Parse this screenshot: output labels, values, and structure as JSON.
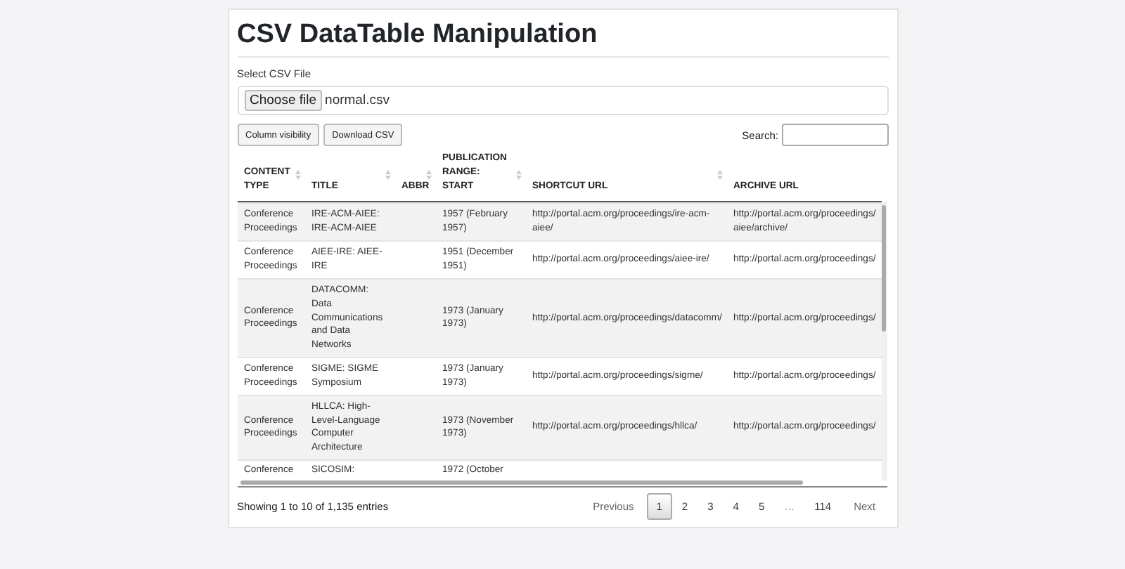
{
  "title": "CSV DataTable Manipulation",
  "file_picker": {
    "label": "Select CSV File",
    "button": "Choose file",
    "file_name": "normal.csv"
  },
  "buttons": [
    "Column visibility",
    "Download CSV"
  ],
  "search": {
    "label": "Search:"
  },
  "table": {
    "columns": [
      {
        "label": "CONTENT TYPE",
        "sortable": true
      },
      {
        "label": "TITLE",
        "sortable": true
      },
      {
        "label": "ABBR",
        "sortable": true
      },
      {
        "label": "PUBLICATION RANGE: START",
        "sortable": true
      },
      {
        "label": "SHORTCUT URL",
        "sortable": true
      },
      {
        "label": "ARCHIVE URL",
        "sortable": false
      }
    ],
    "rows": [
      [
        "Conference Proceedings",
        "IRE-ACM-AIEE: IRE-ACM-AIEE",
        "",
        "1957 (February 1957)",
        "http://portal.acm.org/proceedings/ire-acm-aiee/",
        "http://portal.acm.org/proceedings/ aiee/archive/"
      ],
      [
        "Conference Proceedings",
        "AIEE-IRE: AIEE-IRE",
        "",
        "1951 (December 1951)",
        "http://portal.acm.org/proceedings/aiee-ire/",
        "http://portal.acm.org/proceedings/"
      ],
      [
        "Conference Proceedings",
        "DATACOMM: Data Communications and Data Networks",
        "",
        "1973 (January 1973)",
        "http://portal.acm.org/proceedings/datacomm/",
        "http://portal.acm.org/proceedings/"
      ],
      [
        "Conference Proceedings",
        "SIGME: SIGME Symposium",
        "",
        "1973 (January 1973)",
        "http://portal.acm.org/proceedings/sigme/",
        "http://portal.acm.org/proceedings/"
      ],
      [
        "Conference Proceedings",
        "HLLCA: High-Level-Language Computer Architecture",
        "",
        "1973 (November 1973)",
        "http://portal.acm.org/proceedings/hllca/",
        "http://portal.acm.org/proceedings/"
      ],
      [
        "Conference",
        "SICOSIM:",
        "",
        "1972 (October",
        "",
        ""
      ]
    ]
  },
  "info": "Showing 1 to 10 of 1,135 entries",
  "pagination": [
    {
      "label": "Previous",
      "kind": "nav",
      "selected": false
    },
    {
      "label": "1",
      "kind": "page",
      "selected": true
    },
    {
      "label": "2",
      "kind": "page",
      "selected": false
    },
    {
      "label": "3",
      "kind": "page",
      "selected": false
    },
    {
      "label": "4",
      "kind": "page",
      "selected": false
    },
    {
      "label": "5",
      "kind": "page",
      "selected": false
    },
    {
      "label": "…",
      "kind": "ellipsis",
      "selected": false
    },
    {
      "label": "114",
      "kind": "page",
      "selected": false
    },
    {
      "label": "Next",
      "kind": "nav",
      "selected": false
    }
  ]
}
